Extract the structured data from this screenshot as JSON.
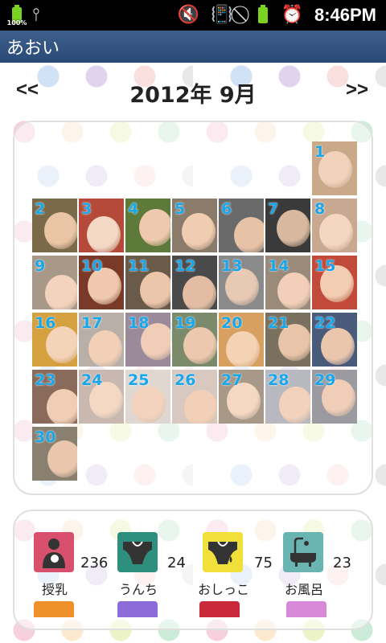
{
  "status_bar": {
    "battery_level": "100%",
    "time": "8:46PM",
    "icons": [
      "battery-icon",
      "usb-icon",
      "mute-icon",
      "vibrate-icon",
      "no-signal-icon",
      "battery-icon",
      "alarm-icon"
    ]
  },
  "title_bar": {
    "title": "あおい"
  },
  "calendar": {
    "prev_label": "<<",
    "next_label": ">>",
    "month_title": "2012年 9月",
    "days": [
      "1",
      "2",
      "3",
      "4",
      "5",
      "6",
      "7",
      "8",
      "9",
      "10",
      "11",
      "12",
      "13",
      "14",
      "15",
      "16",
      "17",
      "18",
      "19",
      "20",
      "21",
      "22",
      "23",
      "24",
      "25",
      "26",
      "27",
      "28",
      "29",
      "30"
    ]
  },
  "stats": [
    {
      "label": "授乳",
      "count": "236",
      "color": "#d9506e",
      "icon": "nursing-icon"
    },
    {
      "label": "うんち",
      "count": "24",
      "color": "#2e8f7f",
      "icon": "diaper-poop-icon"
    },
    {
      "label": "おしっこ",
      "count": "75",
      "color": "#f2e03a",
      "icon": "diaper-pee-icon"
    },
    {
      "label": "お風呂",
      "count": "23",
      "color": "#6ab5b2",
      "icon": "bath-icon"
    }
  ],
  "bottom_row_colors": [
    "#f0902a",
    "#8c6ad8",
    "#c8283a",
    "#d88ad8"
  ]
}
